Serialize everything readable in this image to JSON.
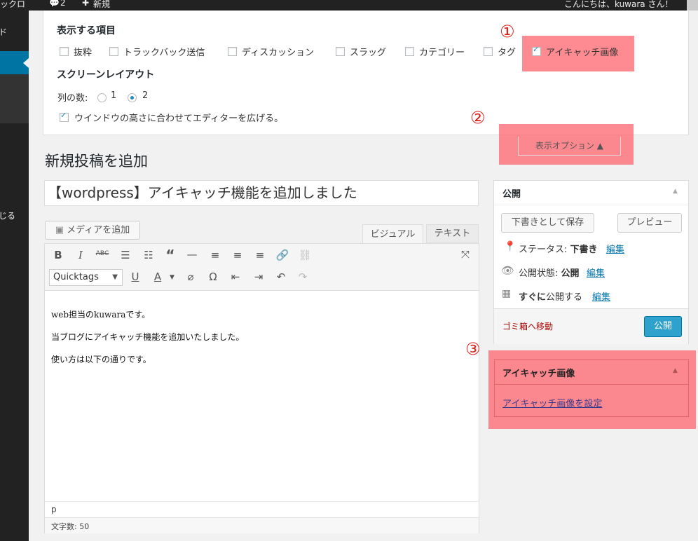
{
  "adminbar": {
    "left_text": "ックロ",
    "comments_count": "2",
    "new_label": "新規",
    "greeting": "こんにちは、kuwara さん！"
  },
  "sidemenu": {
    "item_top": "ド",
    "item_bottom": "じる"
  },
  "screen_options": {
    "show_items_heading": "表示する項目",
    "checkboxes": [
      {
        "label": "抜粋",
        "checked": false
      },
      {
        "label": "トラックバック送信",
        "checked": false
      },
      {
        "label": "ディスカッション",
        "checked": false
      },
      {
        "label": "スラッグ",
        "checked": false
      },
      {
        "label": "カテゴリー",
        "checked": false
      },
      {
        "label": "タグ",
        "checked": false
      },
      {
        "label": "アイキャッチ画像",
        "checked": true
      }
    ],
    "layout_heading": "スクリーンレイアウト",
    "columns_label": "列の数:",
    "radio_1": "1",
    "radio_2": "2",
    "selected_columns": 2,
    "expand_editor_label": "ウインドウの高さに合わせてエディターを広げる。",
    "expand_editor_checked": true,
    "tab_label": "表示オプション ▲"
  },
  "annotations": {
    "n1": "①",
    "n2": "②",
    "n3": "③",
    "highlight_color": "#ff6b73"
  },
  "page": {
    "title": "新規投稿を追加",
    "post_title_value": "【wordpress】アイキャッチ機能を追加しました"
  },
  "editor": {
    "add_media_label": "メディアを追加",
    "tab_visual": "ビジュアル",
    "tab_text": "テキスト",
    "format_select": "Quicktags",
    "content": [
      "web担当のkuwaraです。",
      "当ブログにアイキャッチ機能を追加いたしました。",
      "使い方は以下の通りです。"
    ],
    "path": "p",
    "word_count": "文字数: 50"
  },
  "publish_box": {
    "title": "公開",
    "save_draft": "下書きとして保存",
    "preview": "プレビュー",
    "status_label": "ステータス: ",
    "status_value": "下書き",
    "visibility_label": "公開状態: ",
    "visibility_value": "公開",
    "schedule_label": "すぐに",
    "schedule_rest": "公開する",
    "edit": "編集",
    "trash": "ゴミ箱へ移動",
    "publish_button": "公開"
  },
  "featured_box": {
    "title": "アイキャッチ画像",
    "set_link": "アイキャッチ画像を設定"
  },
  "colors": {
    "primary": "#2ea2cc",
    "admin_bar": "#222222",
    "active_menu": "#0074a2"
  }
}
